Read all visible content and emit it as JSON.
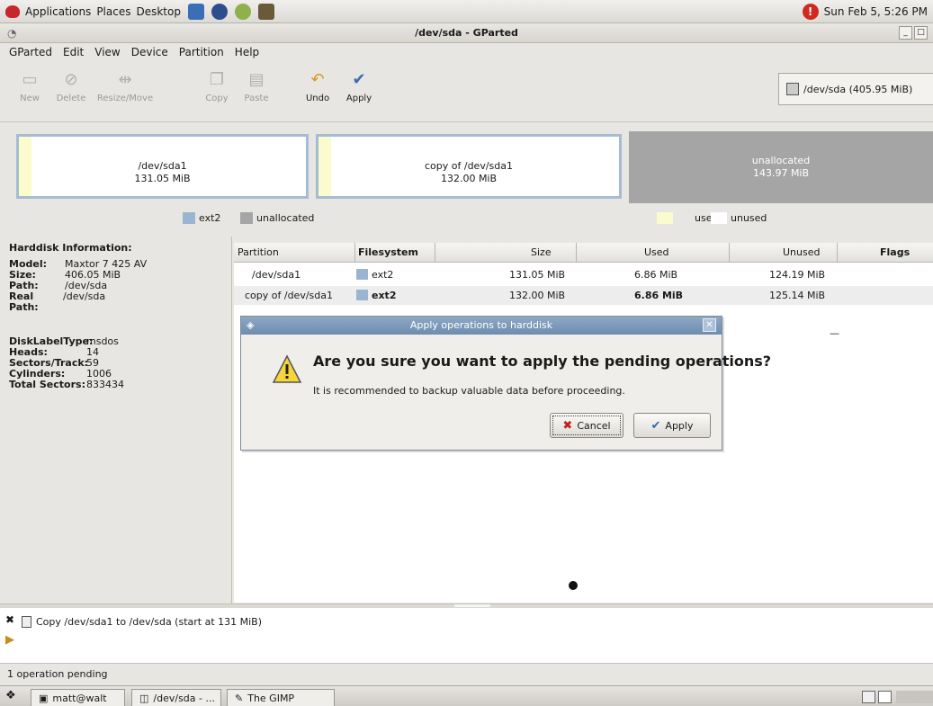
{
  "panel": {
    "menu": [
      "Applications",
      "Places",
      "Desktop"
    ],
    "clock": "Sun Feb 5, 5:26 PM"
  },
  "window": {
    "title": "/dev/sda - GParted"
  },
  "menubar": [
    "GParted",
    "Edit",
    "View",
    "Device",
    "Partition",
    "Help"
  ],
  "toolbar": {
    "new": "New",
    "delete": "Delete",
    "resize_move": "Resize/Move",
    "copy": "Copy",
    "paste": "Paste",
    "undo": "Undo",
    "apply": "Apply",
    "device": "/dev/sda  (405.95 MiB)"
  },
  "graph": {
    "p1_name": "/dev/sda1",
    "p1_size": "131.05 MiB",
    "p2_name": "copy of /dev/sda1",
    "p2_size": "132.00 MiB",
    "p3_name": "unallocated",
    "p3_size": "143.97 MiB"
  },
  "legend": {
    "ext2": "ext2",
    "unallocated": "unallocated",
    "used": "used",
    "unused": "unused",
    "colors": {
      "ext2": "#9bb4cf",
      "unallocated": "#a5a5a5",
      "used": "#fbfbce",
      "unused": "#ffffff"
    }
  },
  "hdinfo": {
    "title": "Harddisk Information:",
    "model_k": "Model:",
    "model_v": "Maxtor 7 425 AV",
    "size_k": "Size:",
    "size_v": "406.05 MiB",
    "path_k": "Path:",
    "path_v": "/dev/sda",
    "realpath_k": "Real Path:",
    "realpath_v": "/dev/sda",
    "disklabel_k": "DiskLabelType:",
    "disklabel_v": "msdos",
    "heads_k": "Heads:",
    "heads_v": "14",
    "sectors_k": "Sectors/Track:",
    "sectors_v": "59",
    "cylinders_k": "Cylinders:",
    "cylinders_v": "1006",
    "total_k": "Total Sectors:",
    "total_v": "833434"
  },
  "table": {
    "headers": {
      "partition": "Partition",
      "filesystem": "Filesystem",
      "size": "Size",
      "used": "Used",
      "unused": "Unused",
      "flags": "Flags"
    },
    "rows": [
      {
        "partition": "/dev/sda1",
        "filesystem": "ext2",
        "size": "131.05 MiB",
        "used": "6.86 MiB",
        "unused": "124.19 MiB"
      },
      {
        "partition": "copy of /dev/sda1",
        "filesystem": "ext2",
        "size": "132.00 MiB",
        "used": "6.86 MiB",
        "unused": "125.14 MiB"
      }
    ],
    "row3_unused": "—"
  },
  "dialog": {
    "title": "Apply operations to harddisk",
    "question": "Are you sure you want to apply the pending operations?",
    "note": "It is recommended to backup valuable data before proceeding.",
    "cancel": "Cancel",
    "apply": "Apply"
  },
  "pending": {
    "op": "Copy /dev/sda1 to /dev/sda (start at 131 MiB)"
  },
  "status": "1 operation pending",
  "taskbar": {
    "t1": "matt@walt",
    "t2": "/dev/sda - ...",
    "t3": "The GIMP"
  }
}
